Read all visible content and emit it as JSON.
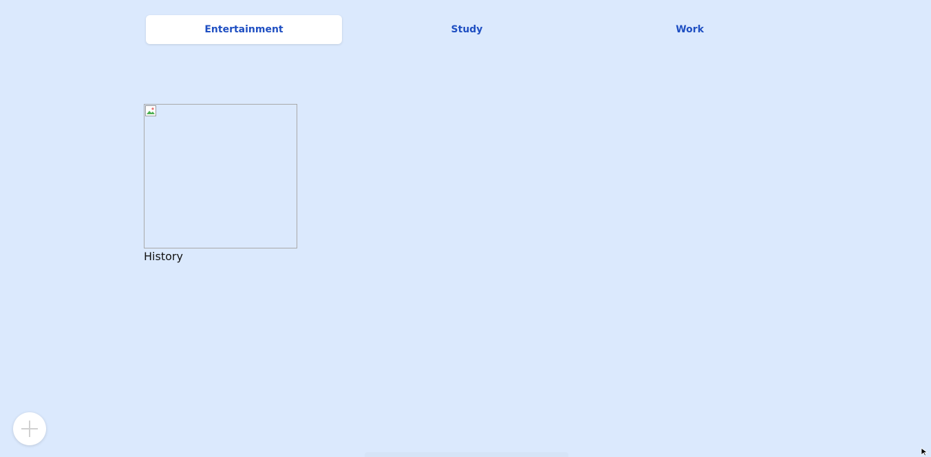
{
  "tabs": [
    {
      "label": "Entertainment",
      "active": true
    },
    {
      "label": "Study",
      "active": false
    },
    {
      "label": "Work",
      "active": false
    }
  ],
  "bookmarks": [
    {
      "label": "History",
      "image": "broken-image-icon"
    }
  ],
  "add_button": {
    "icon": "plus-icon"
  },
  "colors": {
    "background": "#dbe9fd",
    "tab_text": "#1f4fc2",
    "active_tab_bg": "#ffffff"
  }
}
